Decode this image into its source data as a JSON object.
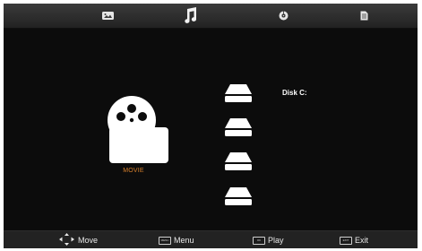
{
  "top_tabs": [
    {
      "icon": "photo-icon"
    },
    {
      "icon": "music-note-icon",
      "selected": true
    },
    {
      "icon": "disc-icon"
    },
    {
      "icon": "document-icon"
    }
  ],
  "main": {
    "movie_label": "MOVIE",
    "disk_label": "Disk C:",
    "drives": [
      {
        "icon": "drive-icon"
      },
      {
        "icon": "drive-icon"
      },
      {
        "icon": "drive-icon"
      },
      {
        "icon": "drive-icon"
      }
    ]
  },
  "footer": {
    "move_label": "Move",
    "menu_label": "Menu",
    "play_label": "Play",
    "exit_label": "Exit",
    "menu_key": "MENU",
    "play_key": "OK",
    "exit_key": "EXIT"
  }
}
